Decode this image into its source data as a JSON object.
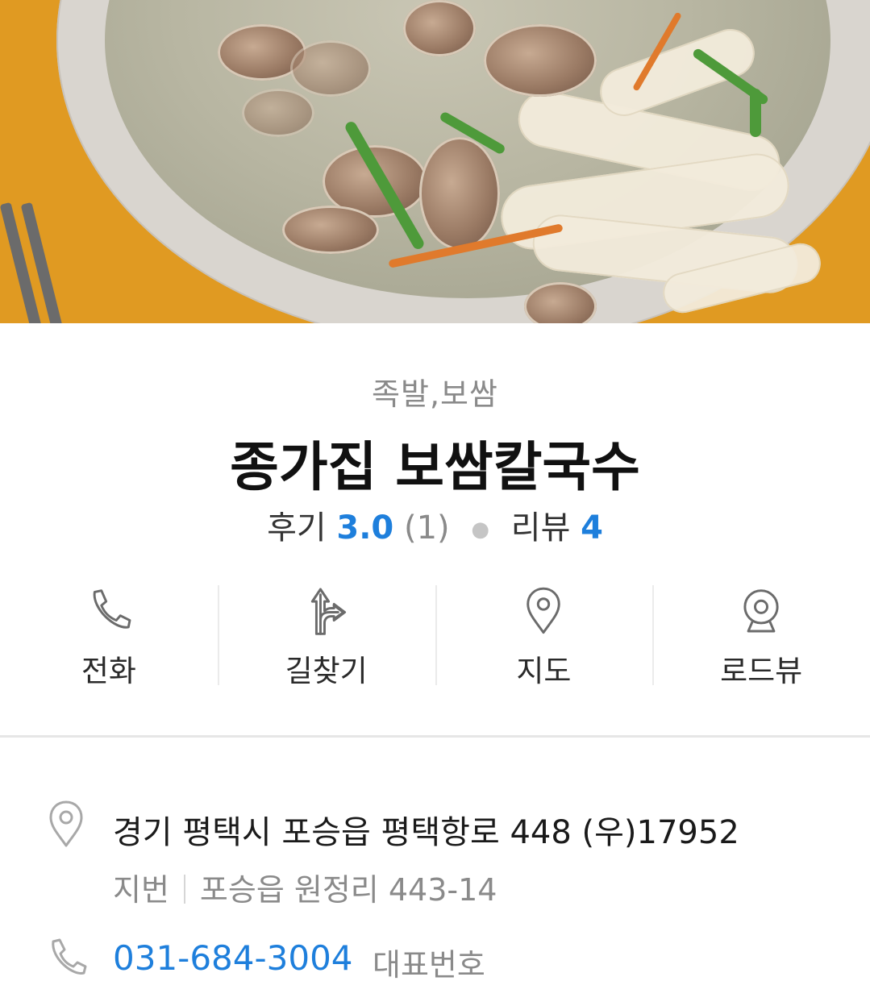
{
  "hero": {
    "image_alt": ""
  },
  "place": {
    "category": "족발,보쌈",
    "name": "종가집 보쌈칼국수",
    "review_label": "후기",
    "review_score": "3.0",
    "review_count": "(1)",
    "blog_review_label": "리뷰",
    "blog_review_count": "4"
  },
  "actions": [
    {
      "label": "전화",
      "icon": "phone-icon"
    },
    {
      "label": "길찾기",
      "icon": "directions-icon"
    },
    {
      "label": "지도",
      "icon": "map-pin-icon"
    },
    {
      "label": "로드뷰",
      "icon": "roadview-icon"
    }
  ],
  "address": {
    "road": "경기 평택시 포승읍 평택항로 448 (우)17952",
    "lot_label": "지번",
    "lot": "포승읍 원정리 443-14"
  },
  "phone": {
    "number": "031-684-3004",
    "label": "대표번호"
  },
  "colors": {
    "accent": "#1e7fdc",
    "muted": "#8a8a8a",
    "icon_stroke": "#6b6b6b"
  }
}
